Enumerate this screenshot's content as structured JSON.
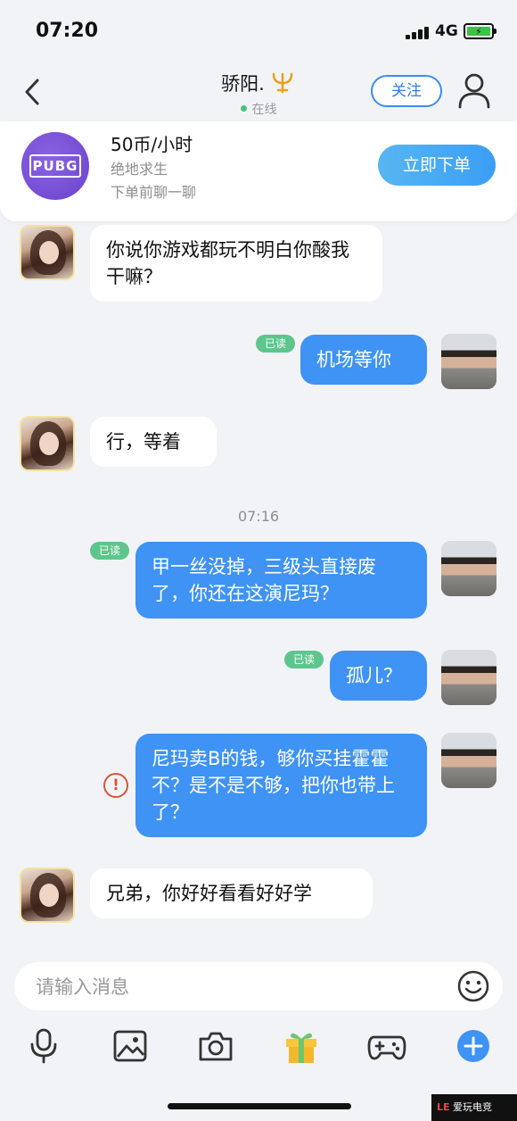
{
  "status_bar": {
    "time": "07:20",
    "network": "4G"
  },
  "header": {
    "nickname": "骄阳.",
    "status": "在线",
    "follow_label": "关注"
  },
  "product": {
    "logo_text": "PUBG",
    "price": "50币/小时",
    "game": "绝地求生",
    "note": "下单前聊一聊",
    "order_label": "立即下单"
  },
  "messages": [
    {
      "side": "in",
      "text": "你说你游戏都玩不明白你酸我干嘛？"
    },
    {
      "side": "out",
      "read": "已读",
      "text": "机场等你"
    },
    {
      "side": "in",
      "text": "行，等着"
    },
    {
      "side": "out",
      "read": "已读",
      "text": "甲一丝没掉，三级头直接废了，你还在这演尼玛？"
    },
    {
      "side": "out",
      "read": "已读",
      "text": "孤儿？"
    },
    {
      "side": "out",
      "failed": true,
      "text": "尼玛卖B的钱，够你买挂霍霍不？是不是不够，把你也带上了？"
    },
    {
      "side": "in",
      "text": "兄弟，你好好看看好好学"
    }
  ],
  "time_divider": "07:16",
  "error_mark": "!",
  "input": {
    "placeholder": "请输入消息"
  },
  "toolbar": [
    "microphone-icon",
    "image-icon",
    "camera-icon",
    "gift-icon",
    "gamepad-icon",
    "plus-icon"
  ],
  "colors": {
    "accent": "#3e93f4",
    "read_badge": "#5ec68c",
    "error": "#d9533a",
    "gift": "#f7c63b"
  },
  "watermark": "爱玩电竞"
}
